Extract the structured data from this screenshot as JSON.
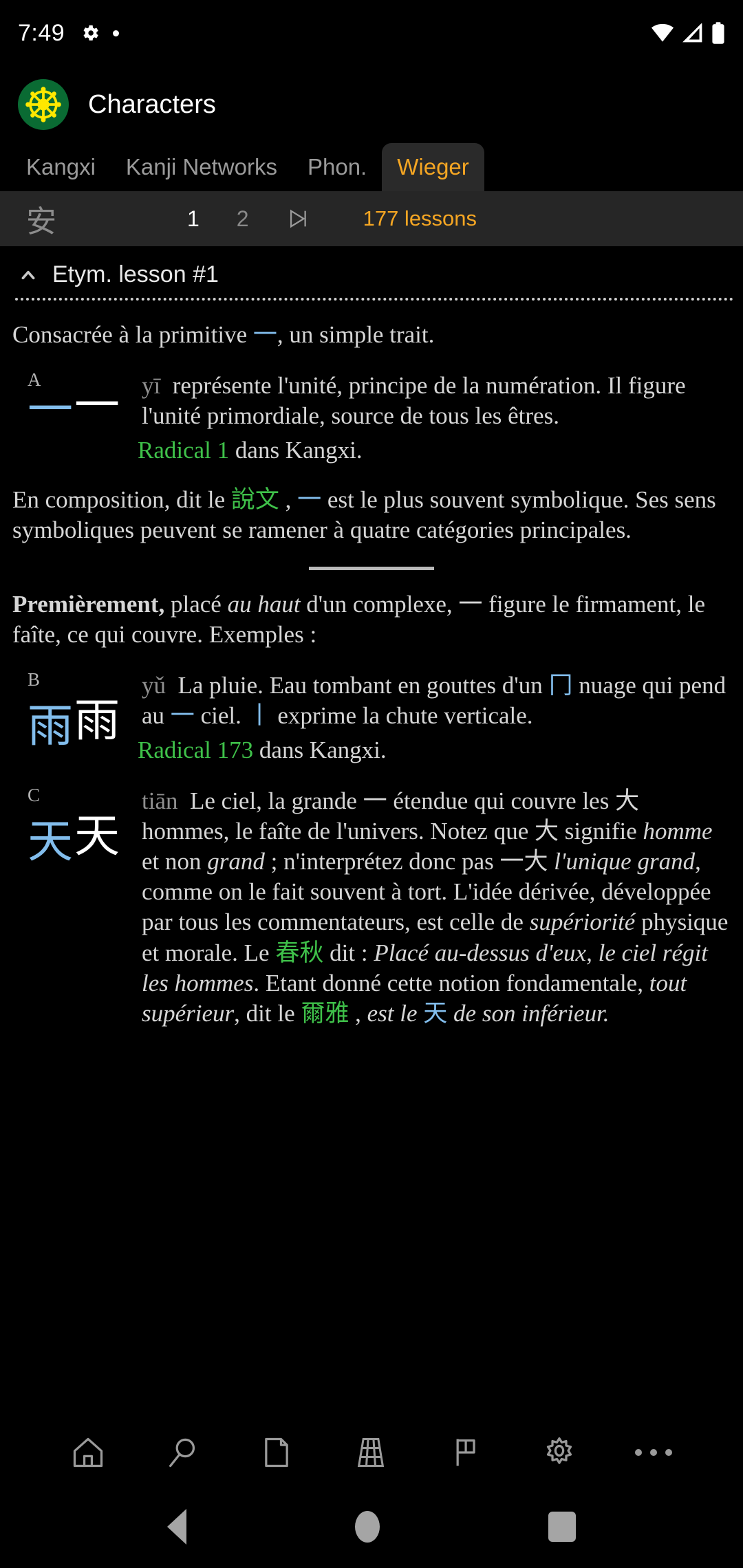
{
  "status_bar": {
    "time": "7:49",
    "left_icons": [
      "gear-icon",
      "dot-icon"
    ],
    "right_icons": [
      "wifi-icon",
      "signal-icon",
      "battery-icon"
    ]
  },
  "app": {
    "title": "Characters",
    "icon": "dharma-wheel-icon",
    "icon_bg": "#0a6b33",
    "icon_fg": "#ffe800"
  },
  "tabs": [
    {
      "label": "Kangxi",
      "active": false
    },
    {
      "label": "Kanji Networks",
      "active": false
    },
    {
      "label": "Phon.",
      "active": false
    },
    {
      "label": "Wieger",
      "active": true
    }
  ],
  "lesson_bar": {
    "character": "安",
    "pages": [
      {
        "label": "1",
        "active": true
      },
      {
        "label": "2",
        "active": false
      }
    ],
    "skip_icon": "skip-next-icon",
    "lesson_count": "177 lessons"
  },
  "lesson": {
    "collapse_icon": "chevron-up-icon",
    "title": "Etym. lesson #1",
    "intro": {
      "before": "Consacrée à la primitive ",
      "glyph": "一",
      "after": ", un simple trait."
    },
    "entries": [
      {
        "letter": "A",
        "modern": "一",
        "ancient": "一",
        "pinyin": "yī",
        "text": "représente l'unité, principe de la numération. Il figure l'unité primordiale, source de tous les êtres.",
        "radical_label": "Radical 1",
        "radical_suffix": "dans Kangxi."
      },
      {
        "letter": "B",
        "modern": "雨",
        "ancient": "雨",
        "pinyin": "yǔ",
        "text_parts": [
          {
            "t": "La pluie. Eau tombant en gouttes d'un "
          },
          {
            "t": "冂",
            "c": "blue cjk"
          },
          {
            "t": " nuage qui pend au "
          },
          {
            "t": "一",
            "c": "blue cjk"
          },
          {
            "t": " ciel. "
          },
          {
            "t": "丨",
            "c": "blue cjk"
          },
          {
            "t": " exprime la chute verticale."
          }
        ],
        "radical_label": "Radical 173",
        "radical_suffix": "dans Kangxi."
      },
      {
        "letter": "C",
        "modern": "天",
        "ancient": "天",
        "pinyin": "tiān",
        "text_parts": [
          {
            "t": "Le ciel, la grande "
          },
          {
            "t": "一"
          },
          {
            "t": " étendue qui couvre les "
          },
          {
            "t": "大",
            "c": "cjk"
          },
          {
            "t": " hommes, le faîte de l'univers. Notez que "
          },
          {
            "t": "大",
            "c": "cjk"
          },
          {
            "t": " signifie "
          },
          {
            "t": "homme",
            "c": "ital"
          },
          {
            "t": " et non "
          },
          {
            "t": "grand",
            "c": "ital"
          },
          {
            "t": " ; n'interprétez donc pas "
          },
          {
            "t": "一大",
            "c": "cjk"
          },
          {
            "t": " "
          },
          {
            "t": "l'unique grand",
            "c": "ital"
          },
          {
            "t": ", comme on le fait souvent à tort. L'idée dérivée, développée par tous les commentateurs, est celle de "
          },
          {
            "t": "supériorité",
            "c": "ital"
          },
          {
            "t": " physique et morale. Le "
          },
          {
            "t": "春秋",
            "c": "green cjk"
          },
          {
            "t": " dit : "
          },
          {
            "t": "Placé au-dessus d'eux, le ciel régit les hommes",
            "c": "ital"
          },
          {
            "t": ". Etant donné cette notion fondamentale, "
          },
          {
            "t": "tout supérieur",
            "c": "ital"
          },
          {
            "t": ", dit le "
          },
          {
            "t": "爾雅",
            "c": "green cjk"
          },
          {
            "t": " , "
          },
          {
            "t": "est le ",
            "c": "ital"
          },
          {
            "t": "天",
            "c": "blue cjk"
          },
          {
            "t": " ",
            "c": "ital"
          },
          {
            "t": "de son inférieur.",
            "c": "ital"
          }
        ]
      }
    ],
    "composition_paragraph": [
      {
        "t": "En composition, dit le "
      },
      {
        "t": "說文",
        "c": "green cjk"
      },
      {
        "t": " , "
      },
      {
        "t": "一",
        "c": "blue cjk"
      },
      {
        "t": " est le plus souvent symbolique. Ses sens symboliques peuvent se ramener à quatre catégories principales."
      }
    ],
    "first_paragraph": [
      {
        "t": "Premièrement,",
        "c": "bold"
      },
      {
        "t": "  placé "
      },
      {
        "t": "au haut",
        "c": "ital"
      },
      {
        "t": " d'un complexe, "
      },
      {
        "t": "一",
        "c": "cjk"
      },
      {
        "t": " figure le firmament, le faîte, ce qui couvre. Exemples :"
      }
    ]
  },
  "bottom_toolbar": [
    {
      "icon": "home-icon",
      "name": "home-button"
    },
    {
      "icon": "search-icon",
      "name": "search-button"
    },
    {
      "icon": "document-icon",
      "name": "document-button"
    },
    {
      "icon": "grid-icon",
      "name": "grid-button"
    },
    {
      "icon": "flag-icon",
      "name": "flag-button"
    },
    {
      "icon": "gear-icon",
      "name": "settings-button"
    },
    {
      "icon": "overflow-icon",
      "name": "more-button"
    }
  ],
  "nav_bar": [
    {
      "icon": "back-icon",
      "name": "nav-back-button"
    },
    {
      "icon": "home-circle-icon",
      "name": "nav-home-button"
    },
    {
      "icon": "recents-icon",
      "name": "nav-recents-button"
    }
  ],
  "colors": {
    "accent_orange": "#f5a623",
    "glyph_blue": "#82bdec",
    "radical_green": "#3fc14a",
    "toolbar_bg": "#262626",
    "page_bg": "#000000"
  }
}
